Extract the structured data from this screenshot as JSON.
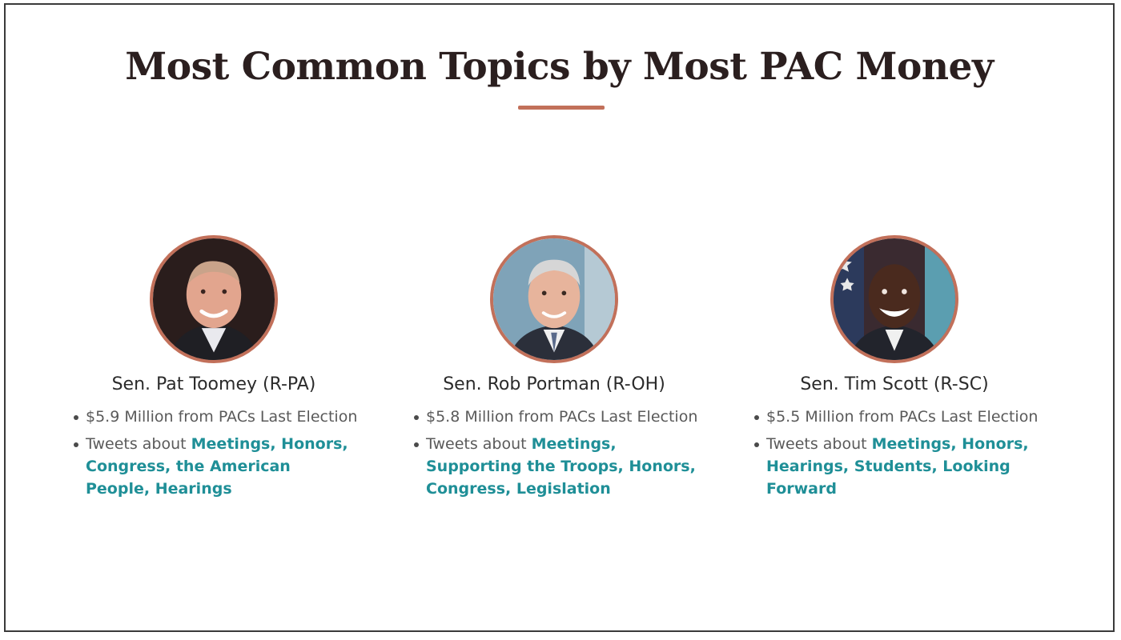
{
  "header": {
    "title": "Most Common Topics by Most PAC Money",
    "accent_color": "#c2705a"
  },
  "senators": [
    {
      "name": "Sen. Pat Toomey (R-PA)",
      "pac_line": "$5.9 Million from PACs Last Election",
      "tweets_prefix": "Tweets about ",
      "topics": "Meetings, Honors, Congress, the American People, Hearings",
      "avatar_icon": "portrait-photo"
    },
    {
      "name": "Sen. Rob Portman (R-OH)",
      "pac_line": "$5.8 Million from PACs Last Election",
      "tweets_prefix": "Tweets about ",
      "topics": "Meetings, Supporting the Troops, Honors, Congress, Legislation",
      "avatar_icon": "portrait-photo"
    },
    {
      "name": "Sen. Tim Scott (R-SC)",
      "pac_line": "$5.5 Million from PACs Last Election",
      "tweets_prefix": "Tweets about ",
      "topics": "Meetings, Honors, Hearings, Students, Looking Forward",
      "avatar_icon": "portrait-photo"
    }
  ],
  "colors": {
    "topic_link": "#1f8f97",
    "body_text": "#5a5a5a",
    "name_text": "#2b2b2b"
  }
}
